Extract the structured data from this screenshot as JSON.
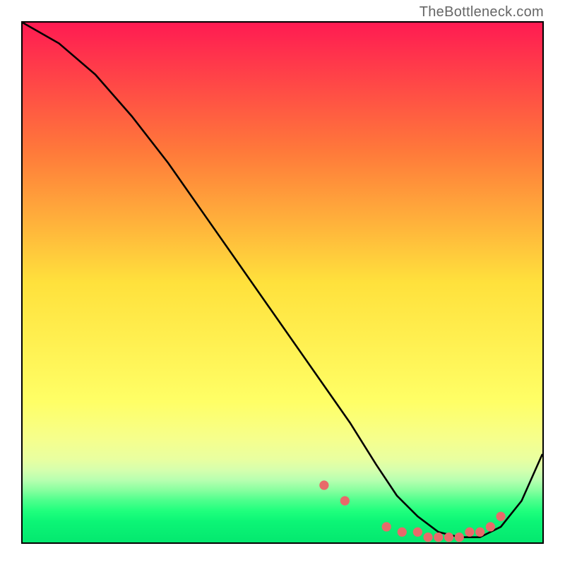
{
  "watermark": "TheBottleneck.com",
  "chart_data": {
    "type": "line",
    "title": "",
    "xlabel": "",
    "ylabel": "",
    "xlim": [
      0,
      100
    ],
    "ylim": [
      0,
      100
    ],
    "gradient_bands": [
      {
        "y": 0,
        "color": "#ff1b52"
      },
      {
        "y": 25,
        "color": "#ff7a3a"
      },
      {
        "y": 50,
        "color": "#ffe13c"
      },
      {
        "y": 73,
        "color": "#ffff66"
      },
      {
        "y": 80,
        "color": "#f6ff8c"
      },
      {
        "y": 84,
        "color": "#e9ffa0"
      },
      {
        "y": 86,
        "color": "#d6ffad"
      },
      {
        "y": 88,
        "color": "#b8ffb0"
      },
      {
        "y": 90,
        "color": "#87ff9f"
      },
      {
        "y": 92,
        "color": "#4cff8c"
      },
      {
        "y": 94,
        "color": "#1fff7d"
      },
      {
        "y": 96,
        "color": "#0cf576"
      },
      {
        "y": 100,
        "color": "#04e86f"
      }
    ],
    "curve": {
      "name": "bottleneck-curve",
      "x": [
        0,
        7,
        14,
        21,
        28,
        35,
        42,
        49,
        56,
        63,
        68,
        72,
        76,
        80,
        84,
        88,
        92,
        96,
        100
      ],
      "y": [
        100,
        96,
        90,
        82,
        73,
        63,
        53,
        43,
        33,
        23,
        15,
        9,
        5,
        2,
        1,
        1,
        3,
        8,
        17
      ]
    },
    "marker_points": {
      "name": "curve-markers",
      "color": "#e86a6a",
      "points_x": [
        58,
        62,
        70,
        73,
        76,
        78,
        80,
        82,
        84,
        86,
        88,
        90,
        92
      ],
      "points_y": [
        11,
        8,
        3,
        2,
        2,
        1,
        1,
        1,
        1,
        2,
        2,
        3,
        5
      ]
    }
  }
}
